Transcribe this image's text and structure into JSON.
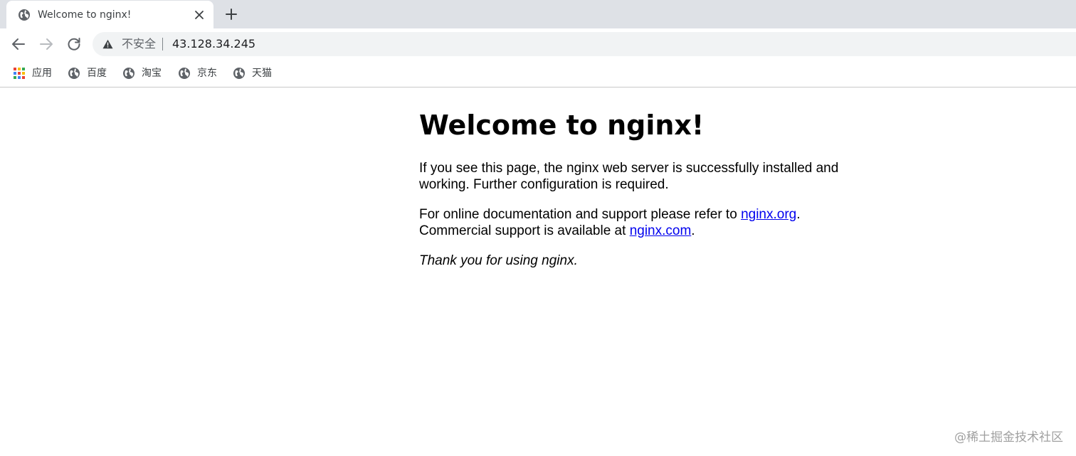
{
  "browser": {
    "tab": {
      "title": "Welcome to nginx!",
      "favicon": "globe-icon"
    },
    "toolbar": {
      "security_label": "不安全",
      "url": "43.128.34.245"
    },
    "bookmarks": [
      {
        "label": "应用",
        "icon": "apps-grid-icon"
      },
      {
        "label": "百度",
        "icon": "globe-icon"
      },
      {
        "label": "淘宝",
        "icon": "globe-icon"
      },
      {
        "label": "京东",
        "icon": "globe-icon"
      },
      {
        "label": "天猫",
        "icon": "globe-icon"
      }
    ]
  },
  "page": {
    "title": "Welcome to nginx!",
    "p1": "If you see this page, the nginx web server is successfully installed and working. Further configuration is required.",
    "p2_before": "For online documentation and support please refer to ",
    "p2_link": "nginx.org",
    "p2_after": ".",
    "p2b_before": "Commercial support is available at ",
    "p2b_link": "nginx.com",
    "p2b_after": ".",
    "p3": "Thank you for using nginx.",
    "link_color": "#0000ee"
  },
  "watermark": "@稀土掘金技术社区"
}
